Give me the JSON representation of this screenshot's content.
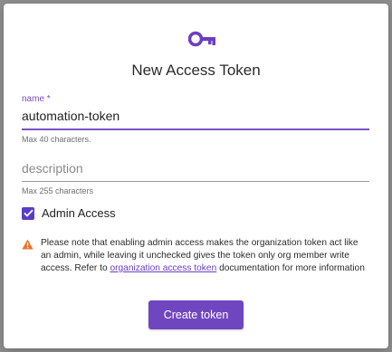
{
  "dialog": {
    "title": "New Access Token",
    "icon": "key-icon"
  },
  "name_field": {
    "label": "name *",
    "value": "automation-token",
    "helper": "Max 40 characters."
  },
  "description_field": {
    "placeholder": "description",
    "value": "",
    "helper": "Max 255 characters"
  },
  "admin_checkbox": {
    "label": "Admin Access",
    "checked": true
  },
  "warning": {
    "icon": "warning-icon",
    "text_before": "Please note that enabling admin access makes the organization token act like an admin, while leaving it unchecked gives the token only org member write access. Refer to ",
    "link_text": "organization access token",
    "text_after": " documentation for more information"
  },
  "actions": {
    "create_label": "Create token"
  },
  "colors": {
    "accent": "#7046c0",
    "warning": "#e8742f",
    "checkbox": "#5b3cc4"
  }
}
